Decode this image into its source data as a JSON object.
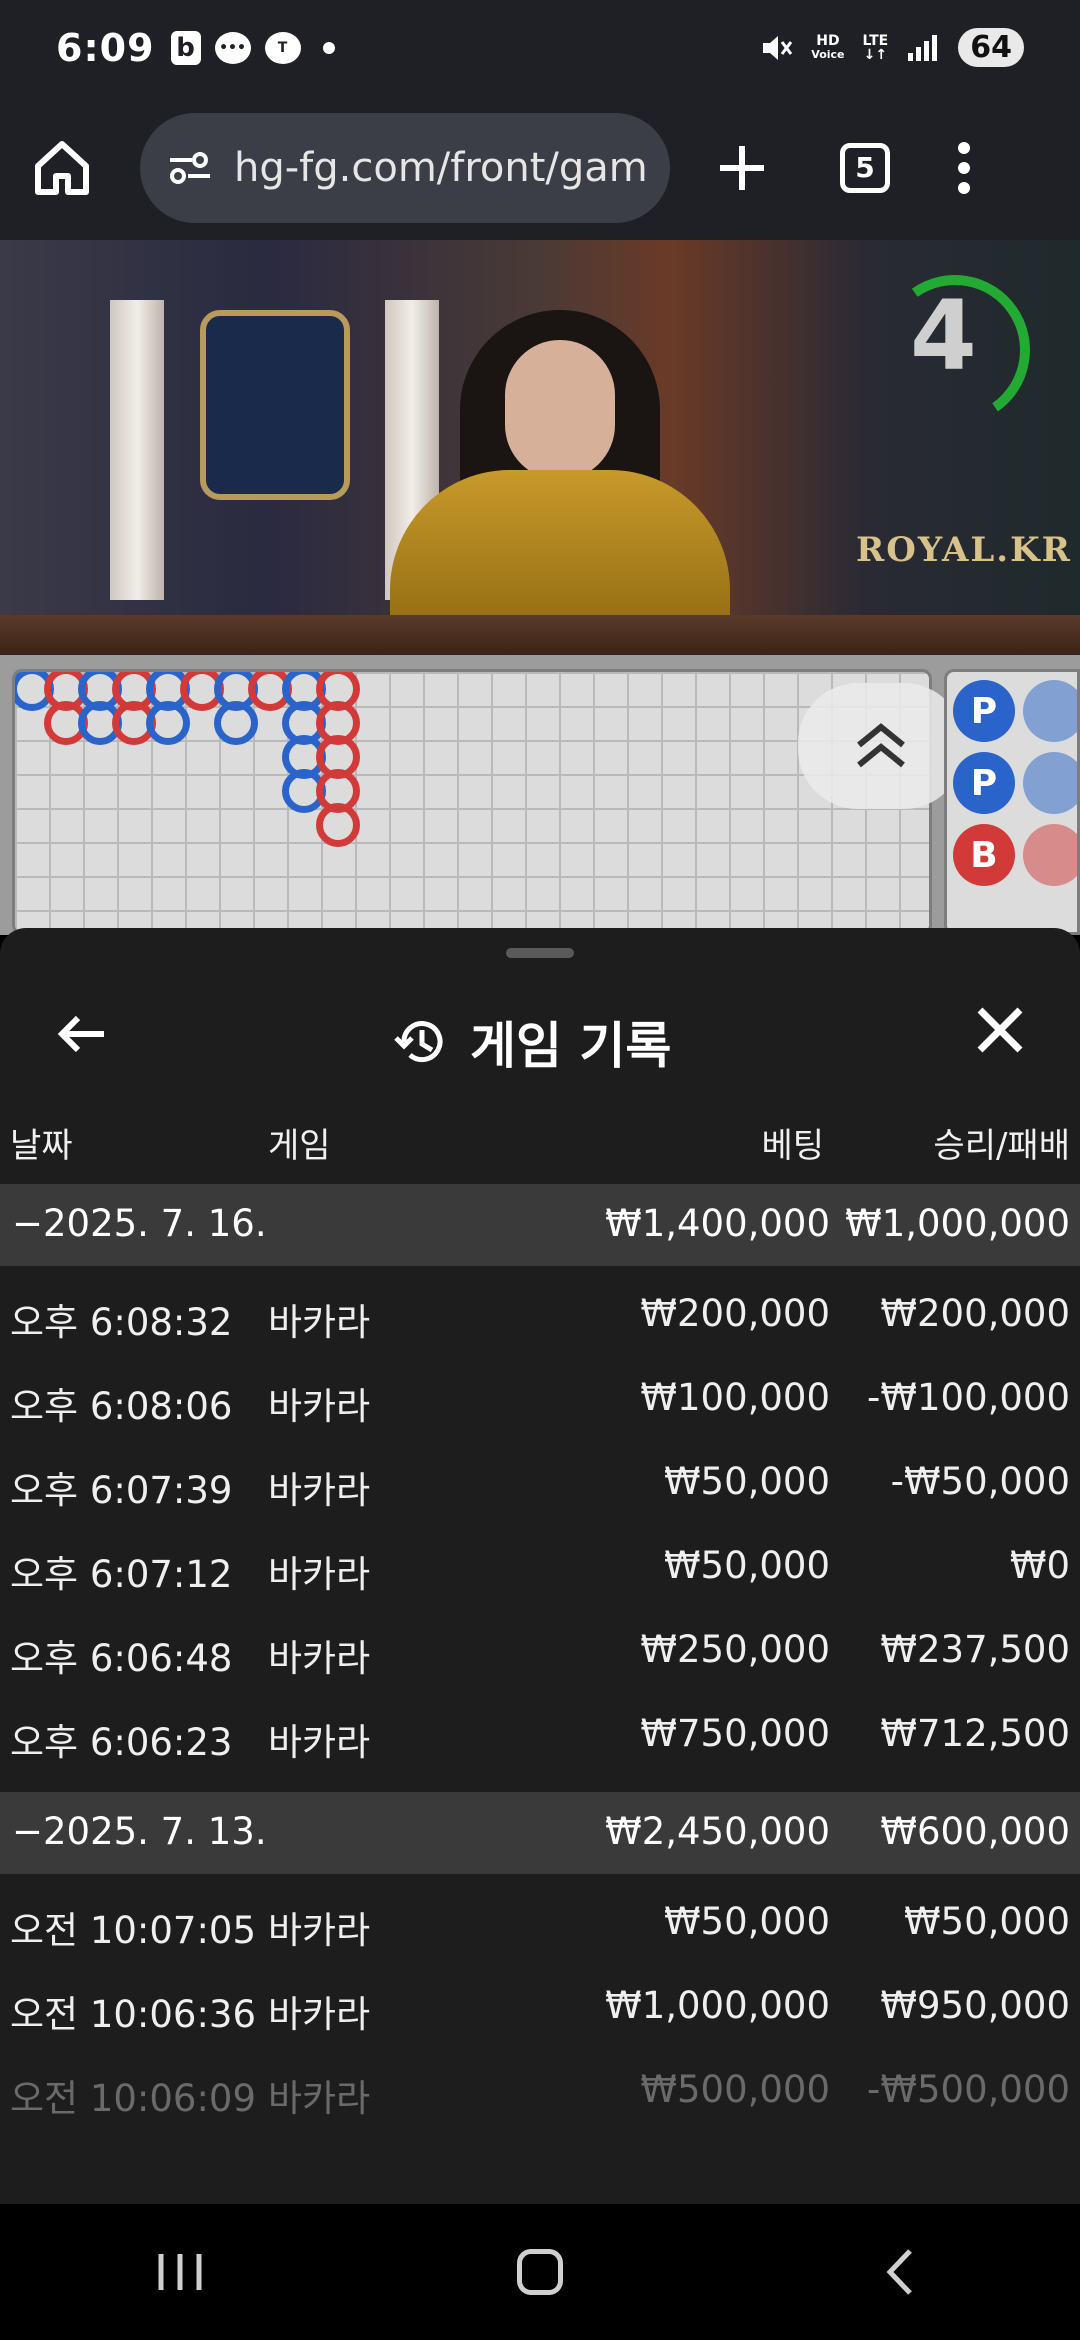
{
  "status_bar": {
    "time": "6:09",
    "hd_label": "HD",
    "voice_label": "Voice",
    "lte_label": "LTE",
    "battery": "64"
  },
  "browser": {
    "url": "hg-fg.com/front/gam",
    "tab_count": "5"
  },
  "video": {
    "countdown": "4",
    "brand": "ROYAL.KR",
    "countdown_color": "#22aa33"
  },
  "roadmap": {
    "scroll_up_icon": "chevrons-up-icon",
    "bead_labels": [
      "P",
      "P",
      "B"
    ]
  },
  "sheet": {
    "title": "게임 기록",
    "title_icon": "history-icon",
    "back_icon": "arrow-left-icon",
    "close_icon": "close-icon",
    "columns": {
      "date": "날짜",
      "game": "게임",
      "bet": "베팅",
      "result": "승리/패배"
    },
    "groups": [
      {
        "date": "−2025. 7. 16.",
        "bet_total": "₩1,400,000",
        "result_total": "₩1,000,000",
        "rows": [
          {
            "time": "오후 6:08:32",
            "game": "바카라",
            "bet": "₩200,000",
            "result": "₩200,000"
          },
          {
            "time": "오후 6:08:06",
            "game": "바카라",
            "bet": "₩100,000",
            "result": "-₩100,000"
          },
          {
            "time": "오후 6:07:39",
            "game": "바카라",
            "bet": "₩50,000",
            "result": "-₩50,000"
          },
          {
            "time": "오후 6:07:12",
            "game": "바카라",
            "bet": "₩50,000",
            "result": "₩0"
          },
          {
            "time": "오후 6:06:48",
            "game": "바카라",
            "bet": "₩250,000",
            "result": "₩237,500"
          },
          {
            "time": "오후 6:06:23",
            "game": "바카라",
            "bet": "₩750,000",
            "result": "₩712,500"
          }
        ]
      },
      {
        "date": "−2025. 7. 13.",
        "bet_total": "₩2,450,000",
        "result_total": "₩600,000",
        "rows": [
          {
            "time": "오전 10:07:05",
            "game": "바카라",
            "bet": "₩50,000",
            "result": "₩50,000"
          },
          {
            "time": "오전 10:06:36",
            "game": "바카라",
            "bet": "₩1,000,000",
            "result": "₩950,000"
          },
          {
            "time": "오전 10:06:09",
            "game": "바카라",
            "bet": "₩500,000",
            "result": "-₩500,000"
          }
        ]
      }
    ]
  },
  "colors": {
    "sheet_bg": "#1d1d1d",
    "group_bg": "#3a3a3a",
    "banker_red": "#d23a3a",
    "player_blue": "#2a63c9"
  }
}
